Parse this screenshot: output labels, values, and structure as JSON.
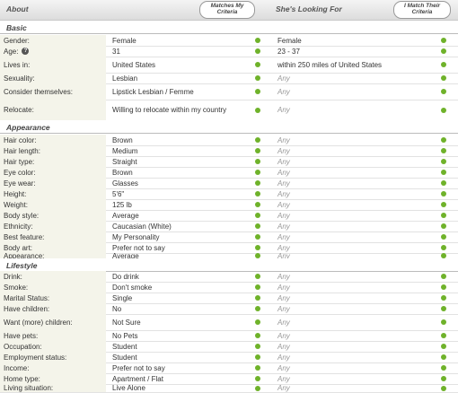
{
  "header": {
    "about": "About",
    "matches_my_criteria": "Matches My Criteria",
    "shes_looking_for": "She's Looking For",
    "i_match_their_criteria": "I Match Their Criteria"
  },
  "sections": [
    {
      "title": "Basic",
      "rows": [
        {
          "label": "Gender:",
          "value": "Female",
          "looking": "Female",
          "any": false
        },
        {
          "label": "Age:",
          "value": "31",
          "looking": "23 - 37",
          "any": false,
          "help": "?"
        },
        {
          "label": "Lives in:",
          "value": "United States",
          "looking": "within 250 miles of United States",
          "any": false
        },
        {
          "label": "Sexuality:",
          "value": "Lesbian",
          "looking": "Any",
          "any": true
        },
        {
          "label": "Consider themselves:",
          "value": "Lipstick Lesbian / Femme",
          "looking": "Any",
          "any": true
        },
        {
          "label": "Relocate:",
          "value": "Willing to relocate within my country",
          "looking": "Any",
          "any": true
        }
      ]
    },
    {
      "title": "Appearance",
      "rows": [
        {
          "label": "Hair color:",
          "value": "Brown",
          "looking": "Any",
          "any": true
        },
        {
          "label": "Hair length:",
          "value": "Medium",
          "looking": "Any",
          "any": true
        },
        {
          "label": "Hair type:",
          "value": "Straight",
          "looking": "Any",
          "any": true
        },
        {
          "label": "Eye color:",
          "value": "Brown",
          "looking": "Any",
          "any": true
        },
        {
          "label": "Eye wear:",
          "value": "Glasses",
          "looking": "Any",
          "any": true
        },
        {
          "label": "Height:",
          "value": "5'6\"",
          "looking": "Any",
          "any": true
        },
        {
          "label": "Weight:",
          "value": "125 lb",
          "looking": "Any",
          "any": true
        },
        {
          "label": "Body style:",
          "value": "Average",
          "looking": "Any",
          "any": true
        },
        {
          "label": "Ethnicity:",
          "value": "Caucasian (White)",
          "looking": "Any",
          "any": true
        },
        {
          "label": "Best feature:",
          "value": "My Personality",
          "looking": "Any",
          "any": true
        },
        {
          "label": "Body art:",
          "value": "Prefer not to say",
          "looking": "Any",
          "any": true
        },
        {
          "label": "Appearance:",
          "value": "Average",
          "looking": "Any",
          "any": true
        }
      ]
    },
    {
      "title": "Lifestyle",
      "rows": [
        {
          "label": "Drink:",
          "value": "Do drink",
          "looking": "Any",
          "any": true
        },
        {
          "label": "Smoke:",
          "value": "Don't smoke",
          "looking": "Any",
          "any": true
        },
        {
          "label": "Marital Status:",
          "value": "Single",
          "looking": "Any",
          "any": true
        },
        {
          "label": "Have children:",
          "value": "No",
          "looking": "Any",
          "any": true
        },
        {
          "label": "Want (more) children:",
          "value": "Not Sure",
          "looking": "Any",
          "any": true
        },
        {
          "label": "Have pets:",
          "value": "No Pets",
          "looking": "Any",
          "any": true
        },
        {
          "label": "Occupation:",
          "value": "Student",
          "looking": "Any",
          "any": true
        },
        {
          "label": "Employment status:",
          "value": "Student",
          "looking": "Any",
          "any": true
        },
        {
          "label": "Income:",
          "value": "Prefer not to say",
          "looking": "Any",
          "any": true
        },
        {
          "label": "Home type:",
          "value": "Apartment / Flat",
          "looking": "Any",
          "any": true
        },
        {
          "label": "Living situation:",
          "value": "Live Alone",
          "looking": "Any",
          "any": true
        }
      ]
    }
  ],
  "colors": {
    "match_dot": "#6fb22a",
    "label_bg": "#f4f4ea"
  }
}
